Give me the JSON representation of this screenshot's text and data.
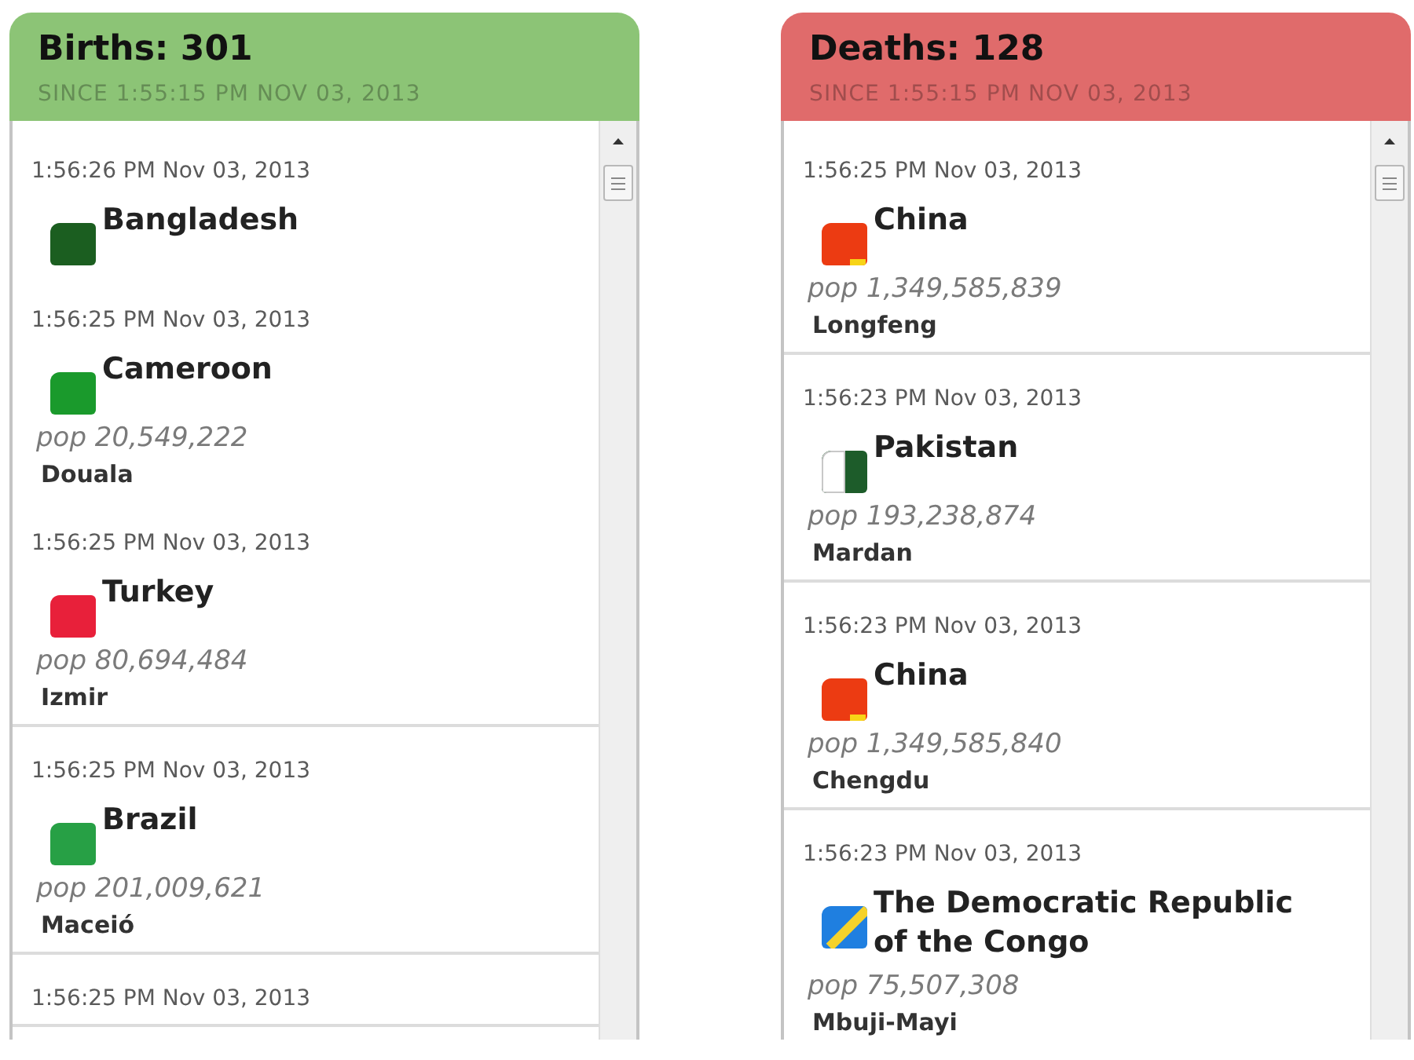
{
  "panels": [
    {
      "title": "Births: 301",
      "subtitle": "SINCE 1:55:15 PM NOV 03, 2013",
      "color": "#8cc476",
      "groups": [
        {
          "entries": [
            {
              "time": "1:56:26 PM Nov 03, 2013",
              "flag": {
                "kind": "plain",
                "color": "#1b5e20"
              },
              "country": "Bangladesh"
            },
            {
              "time": "1:56:25 PM Nov 03, 2013",
              "flag": {
                "kind": "plain",
                "color": "#1a9a2c"
              },
              "country": "Cameroon",
              "population": "pop 20,549,222",
              "city": "Douala"
            },
            {
              "time": "1:56:25 PM Nov 03, 2013",
              "flag": {
                "kind": "plain",
                "color": "#e8203a"
              },
              "country": "Turkey",
              "population": "pop 80,694,484",
              "city": "Izmir"
            }
          ]
        },
        {
          "entries": [
            {
              "time": "1:56:25 PM Nov 03, 2013",
              "flag": {
                "kind": "plain",
                "color": "#27a045"
              },
              "country": "Brazil",
              "population": "pop 201,009,621",
              "city": "Maceió"
            }
          ]
        },
        {
          "entries": [
            {
              "time": "1:56:25 PM Nov 03, 2013"
            }
          ]
        }
      ]
    },
    {
      "title": "Deaths: 128",
      "subtitle": "SINCE 1:55:15 PM NOV 03, 2013",
      "color": "#e06b6b",
      "groups": [
        {
          "entries": [
            {
              "time": "1:56:25 PM Nov 03, 2013",
              "flag": {
                "kind": "corner",
                "color": "#ec3b12"
              },
              "country": "China",
              "population": "pop 1,349,585,839",
              "city": "Longfeng"
            }
          ]
        },
        {
          "entries": [
            {
              "time": "1:56:23 PM Nov 03, 2013",
              "flag": {
                "kind": "hoist",
                "color": "#1d5c2a"
              },
              "country": "Pakistan",
              "population": "pop 193,238,874",
              "city": "Mardan"
            }
          ]
        },
        {
          "entries": [
            {
              "time": "1:56:23 PM Nov 03, 2013",
              "flag": {
                "kind": "corner",
                "color": "#ec3b12"
              },
              "country": "China",
              "population": "pop 1,349,585,840",
              "city": "Chengdu"
            }
          ]
        },
        {
          "entries": [
            {
              "time": "1:56:23 PM Nov 03, 2013",
              "flag": {
                "kind": "diagonal",
                "color": "#1f7fe0"
              },
              "country": "The Democratic Republic of the Congo",
              "population": "pop 75,507,308",
              "city": "Mbuji-Mayi"
            }
          ]
        }
      ]
    }
  ]
}
